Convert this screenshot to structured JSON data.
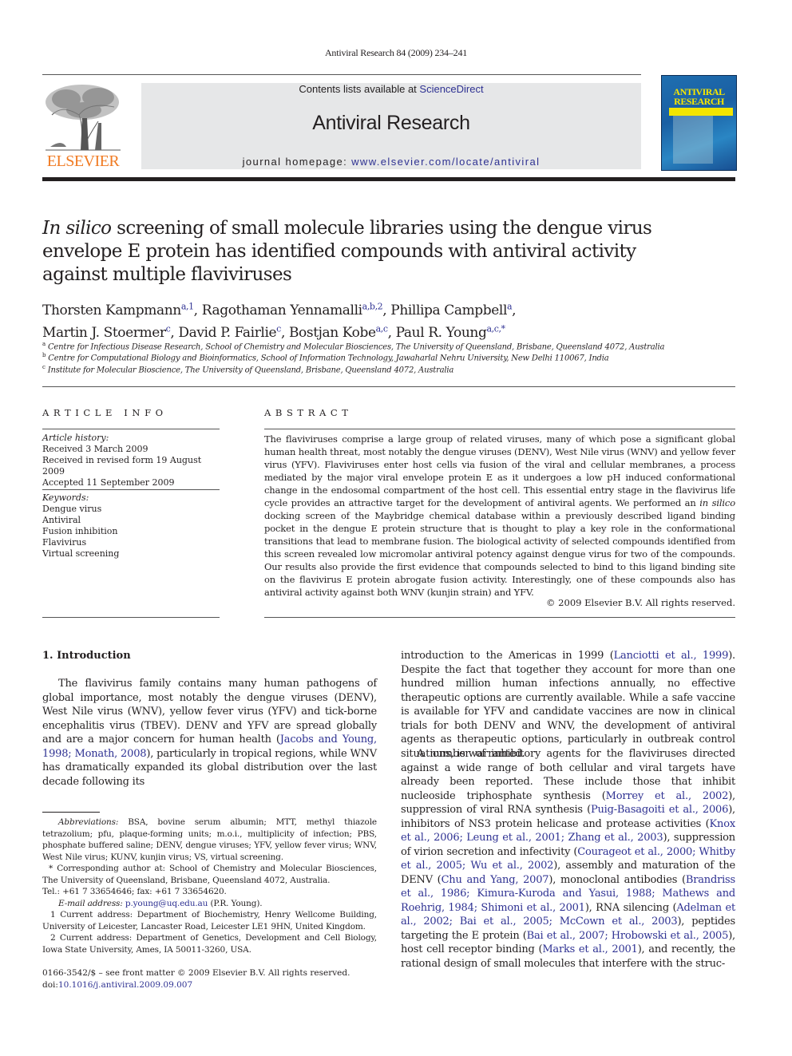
{
  "running_head": "Antiviral Research 84 (2009) 234–241",
  "masthead": {
    "publisher": "ELSEVIER",
    "contents_prefix": "Contents lists available at ",
    "contents_link": "ScienceDirect",
    "journal_title": "Antiviral Research",
    "homepage_prefix": "journal homepage: ",
    "homepage_link": "www.elsevier.com/locate/antiviral",
    "cover_title_1": "ANTIVIRAL",
    "cover_title_2": "RESEARCH"
  },
  "article": {
    "title_italic": "In silico",
    "title_rest": " screening of small molecule libraries using the dengue virus envelope E protein has identified compounds with antiviral activity against multiple flaviviruses",
    "authors": [
      {
        "name": "Thorsten Kampmann",
        "sup": "a,1",
        "sep": ", "
      },
      {
        "name": "Ragothaman Yennamalli",
        "sup": "a,b,2",
        "sep": ", "
      },
      {
        "name": "Phillipa Campbell",
        "sup": "a",
        "sep": ","
      },
      {
        "name": "Martin J. Stoermer",
        "sup": "c",
        "sep": ", "
      },
      {
        "name": "David P. Fairlie",
        "sup": "c",
        "sep": ", "
      },
      {
        "name": "Bostjan Kobe",
        "sup": "a,c",
        "sep": ", "
      },
      {
        "name": "Paul R. Young",
        "sup": "a,c,*",
        "sep": ""
      }
    ],
    "affiliations": [
      {
        "mark": "a",
        "text": "Centre for Infectious Disease Research, School of Chemistry and Molecular Biosciences, The University of Queensland, Brisbane, Queensland 4072, Australia"
      },
      {
        "mark": "b",
        "text": "Centre for Computational Biology and Bioinformatics, School of Information Technology, Jawaharlal Nehru University, New Delhi 110067, India"
      },
      {
        "mark": "c",
        "text": "Institute for Molecular Bioscience, The University of Queensland, Brisbane, Queensland 4072, Australia"
      }
    ]
  },
  "article_info": {
    "heading": "ARTICLE INFO",
    "history_label": "Article history:",
    "history": [
      "Received 3 March 2009",
      "Received in revised form 19 August 2009",
      "Accepted 11 September 2009"
    ],
    "keywords_label": "Keywords:",
    "keywords": [
      "Dengue virus",
      "Antiviral",
      "Fusion inhibition",
      "Flavivirus",
      "Virtual screening"
    ]
  },
  "abstract": {
    "heading": "ABSTRACT",
    "part1": "The flaviviruses comprise a large group of related viruses, many of which pose a significant global human health threat, most notably the dengue viruses (DENV), West Nile virus (WNV) and yellow fever virus (YFV). Flaviviruses enter host cells via fusion of the viral and cellular membranes, a process mediated by the major viral envelope protein E as it undergoes a low pH induced conformational change in the endosomal compartment of the host cell. This essential entry stage in the flavivirus life cycle provides an attractive target for the development of antiviral agents. We performed an ",
    "italic": "in silico",
    "part2": " docking screen of the Maybridge chemical database within a previously described ligand binding pocket in the dengue E protein structure that is thought to play a key role in the conformational transitions that lead to membrane fusion. The biological activity of selected compounds identified from this screen revealed low micromolar antiviral potency against dengue virus for two of the compounds. Our results also provide the first evidence that compounds selected to bind to this ligand binding site on the flavivirus E protein abrogate fusion activity. Interestingly, one of these compounds also has antiviral activity against both WNV (kunjin strain) and YFV.",
    "copyright": "© 2009 Elsevier B.V. All rights reserved."
  },
  "introduction": {
    "heading": "1.  Introduction",
    "col1_p1_a": "The flavivirus family contains many human pathogens of global importance, most notably the dengue viruses (DENV), West Nile virus (WNV), yellow fever virus (YFV) and tick-borne encephalitis virus (TBEV). DENV and YFV are spread globally and are a major concern for human health (",
    "col1_cite1": "Jacobs and Young, 1998; Monath, 2008",
    "col1_p1_b": "), particularly in tropical regions, while WNV has dramatically expanded its global distribution over the last decade following its",
    "col2_p1_a": "introduction to the Americas in 1999 (",
    "col2_cite1": "Lanciotti et al., 1999",
    "col2_p1_b": "). Despite the fact that together they account for more than one hundred million human infections annually, no effective therapeutic options are currently available. While a safe vaccine is available for YFV and candidate vaccines are now in clinical trials for both DENV and WNV, the development of antiviral agents as therapeutic options, particularly in outbreak control situations, is warranted.",
    "col2_p2": [
      {
        "t": "A number of inhibitory agents for the flaviviruses directed against a wide range of both cellular and viral targets have already been reported. These include those that inhibit nucleoside triphosphate synthesis (",
        "c": "Morrey et al., 2002"
      },
      {
        "t": "), suppression of viral RNA synthesis (",
        "c": "Puig-Basagoiti et al., 2006"
      },
      {
        "t": "), inhibitors of NS3 protein helicase and protease activities (",
        "c": "Knox et al., 2006; Leung et al., 2001; Zhang et al., 2003"
      },
      {
        "t": "), suppression of virion secretion and infectivity (",
        "c": "Courageot et al., 2000; Whitby et al., 2005; Wu et al., 2002"
      },
      {
        "t": "), assembly and maturation of the DENV (",
        "c": "Chu and Yang, 2007"
      },
      {
        "t": "), monoclonal antibodies (",
        "c": "Brandriss et al., 1986; Kimura-Kuroda and Yasui, 1988; Mathews and Roehrig, 1984; Shimoni et al., 2001"
      },
      {
        "t": "), RNA silencing (",
        "c": "Adelman et al., 2002; Bai et al., 2005; McCown et al., 2003"
      },
      {
        "t": "), peptides targeting the E protein (",
        "c": "Bai et al., 2007; Hrobowski et al., 2005"
      },
      {
        "t": "), host cell receptor binding (",
        "c": "Marks et al., 2001"
      },
      {
        "t": "), and recently, the rational design of small molecules that interfere with the struc-",
        "c": ""
      }
    ]
  },
  "footnotes": {
    "abbrev_label": "Abbreviations:",
    "abbrev_text": "  BSA, bovine serum albumin; MTT, methyl thiazole tetrazolium; pfu, plaque-forming units; m.o.i., multiplicity of infection; PBS, phosphate buffered saline; DENV, dengue viruses; YFV, yellow fever virus; WNV, West Nile virus; KUNV, kunjin virus; VS, virtual screening.",
    "corresponding": "* Corresponding author at: School of Chemistry and Molecular Biosciences, The University of Queensland, Brisbane, Queensland 4072, Australia.",
    "tel": "Tel.: +61 7 33654646; fax: +61 7 33654620.",
    "email_label": "E-mail address:",
    "email": "p.young@uq.edu.au",
    "email_suffix": " (P.R. Young).",
    "fn1": "1  Current address: Department of Biochemistry, Henry Wellcome Building, University of Leicester, Lancaster Road, Leicester LE1 9HN, United Kingdom.",
    "fn2": "2  Current address: Department of Genetics, Development and Cell Biology, Iowa State University, Ames, IA 50011-3260, USA."
  },
  "bottom": {
    "issn": "0166-3542/$ – see front matter © 2009 Elsevier B.V. All rights reserved.",
    "doi_prefix": "doi:",
    "doi": "10.1016/j.antiviral.2009.09.007"
  }
}
